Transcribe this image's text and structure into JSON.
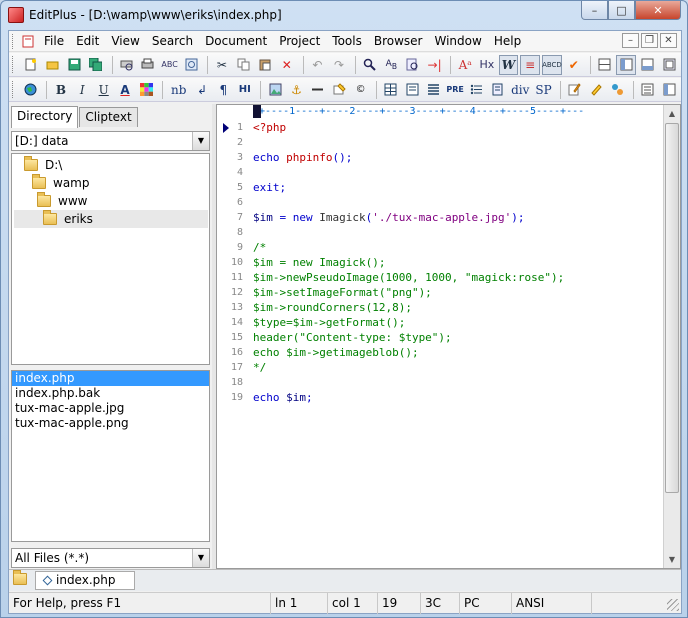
{
  "window": {
    "title": "EditPlus - [D:\\wamp\\www\\eriks\\index.php]",
    "min": "–",
    "max": "□",
    "close": "✕"
  },
  "menu": [
    "File",
    "Edit",
    "View",
    "Search",
    "Document",
    "Project",
    "Tools",
    "Browser",
    "Window",
    "Help"
  ],
  "toolbar1": [
    "new-file-icon",
    "open-file-icon",
    "save-icon",
    "save-all-icon",
    "print-preview-icon",
    "print-icon",
    "spell-check-icon",
    "browser-preview-icon",
    "cut-icon",
    "copy-icon",
    "paste-icon",
    "delete-icon",
    "undo-icon",
    "redo-icon",
    "find-icon",
    "replace-icon",
    "find-in-files-icon",
    "go-to-icon",
    "font-icon",
    "hex-icon",
    "word-wrap-icon",
    "line-number-icon",
    "column-select-icon",
    "check-icon",
    "split-icon",
    "file-window-icon",
    "output-window-icon",
    "full-screen-icon"
  ],
  "toolbar2": {
    "labels": {
      "b": "B",
      "i": "I",
      "u": "U",
      "a": "A",
      "nb": "nb",
      "br": "↲",
      "para": "¶",
      "h": "HI",
      "pre": "PRE",
      "div": "div",
      "sp": "SP",
      "anchor": "⚓",
      "copy": "©"
    }
  },
  "sidebar": {
    "tabs": [
      "Directory",
      "Cliptext"
    ],
    "drive": "[D:] data",
    "tree": [
      {
        "label": "D:\\",
        "depth": 0
      },
      {
        "label": "wamp",
        "depth": 1
      },
      {
        "label": "www",
        "depth": 2
      },
      {
        "label": "eriks",
        "depth": 3,
        "selected": true
      }
    ],
    "files": [
      {
        "name": "index.php",
        "selected": true
      },
      {
        "name": "index.php.bak"
      },
      {
        "name": "tux-mac-apple.jpg"
      },
      {
        "name": "tux-mac-apple.png"
      }
    ],
    "filter": "All Files (*.*)"
  },
  "editor": {
    "ruler": "-+----1----+----2----+----3----+----4----+----5----+---",
    "lines": [
      [
        {
          "t": "<?php",
          "c": "f"
        }
      ],
      [],
      [
        {
          "t": "echo ",
          "c": "k"
        },
        {
          "t": "phpinfo",
          "c": "f"
        },
        {
          "t": "();",
          "c": "k"
        }
      ],
      [],
      [
        {
          "t": "exit;",
          "c": "k"
        }
      ],
      [],
      [
        {
          "t": "$im",
          "c": "v"
        },
        {
          "t": " = new ",
          "c": "k"
        },
        {
          "t": "Imagick",
          "c": "t"
        },
        {
          "t": "(",
          "c": "k"
        },
        {
          "t": "'./tux-mac-apple.jpg'",
          "c": "s"
        },
        {
          "t": ");",
          "c": "k"
        }
      ],
      [],
      [
        {
          "t": "/*",
          "c": "c"
        }
      ],
      [
        {
          "t": "$im = new Imagick();",
          "c": "c"
        }
      ],
      [
        {
          "t": "$im->newPseudoImage(1000, 1000, \"magick:rose\");",
          "c": "c"
        }
      ],
      [
        {
          "t": "$im->setImageFormat(\"png\");",
          "c": "c"
        }
      ],
      [
        {
          "t": "$im->roundCorners(12,8);",
          "c": "c"
        }
      ],
      [
        {
          "t": "$type=$im->getFormat();",
          "c": "c"
        }
      ],
      [
        {
          "t": "header(\"Content-type: $type\");",
          "c": "c"
        }
      ],
      [
        {
          "t": "echo $im->getimageblob();",
          "c": "c"
        }
      ],
      [
        {
          "t": "*/",
          "c": "c"
        }
      ],
      [],
      [
        {
          "t": "echo ",
          "c": "k"
        },
        {
          "t": "$im",
          "c": "v"
        },
        {
          "t": ";",
          "c": "k"
        }
      ]
    ]
  },
  "filetab": "index.php",
  "status": {
    "help": "For Help, press F1",
    "ln": "ln 1",
    "col": "col 1",
    "chars": "19",
    "hex": "3C",
    "mode": "PC",
    "enc": "ANSI"
  }
}
